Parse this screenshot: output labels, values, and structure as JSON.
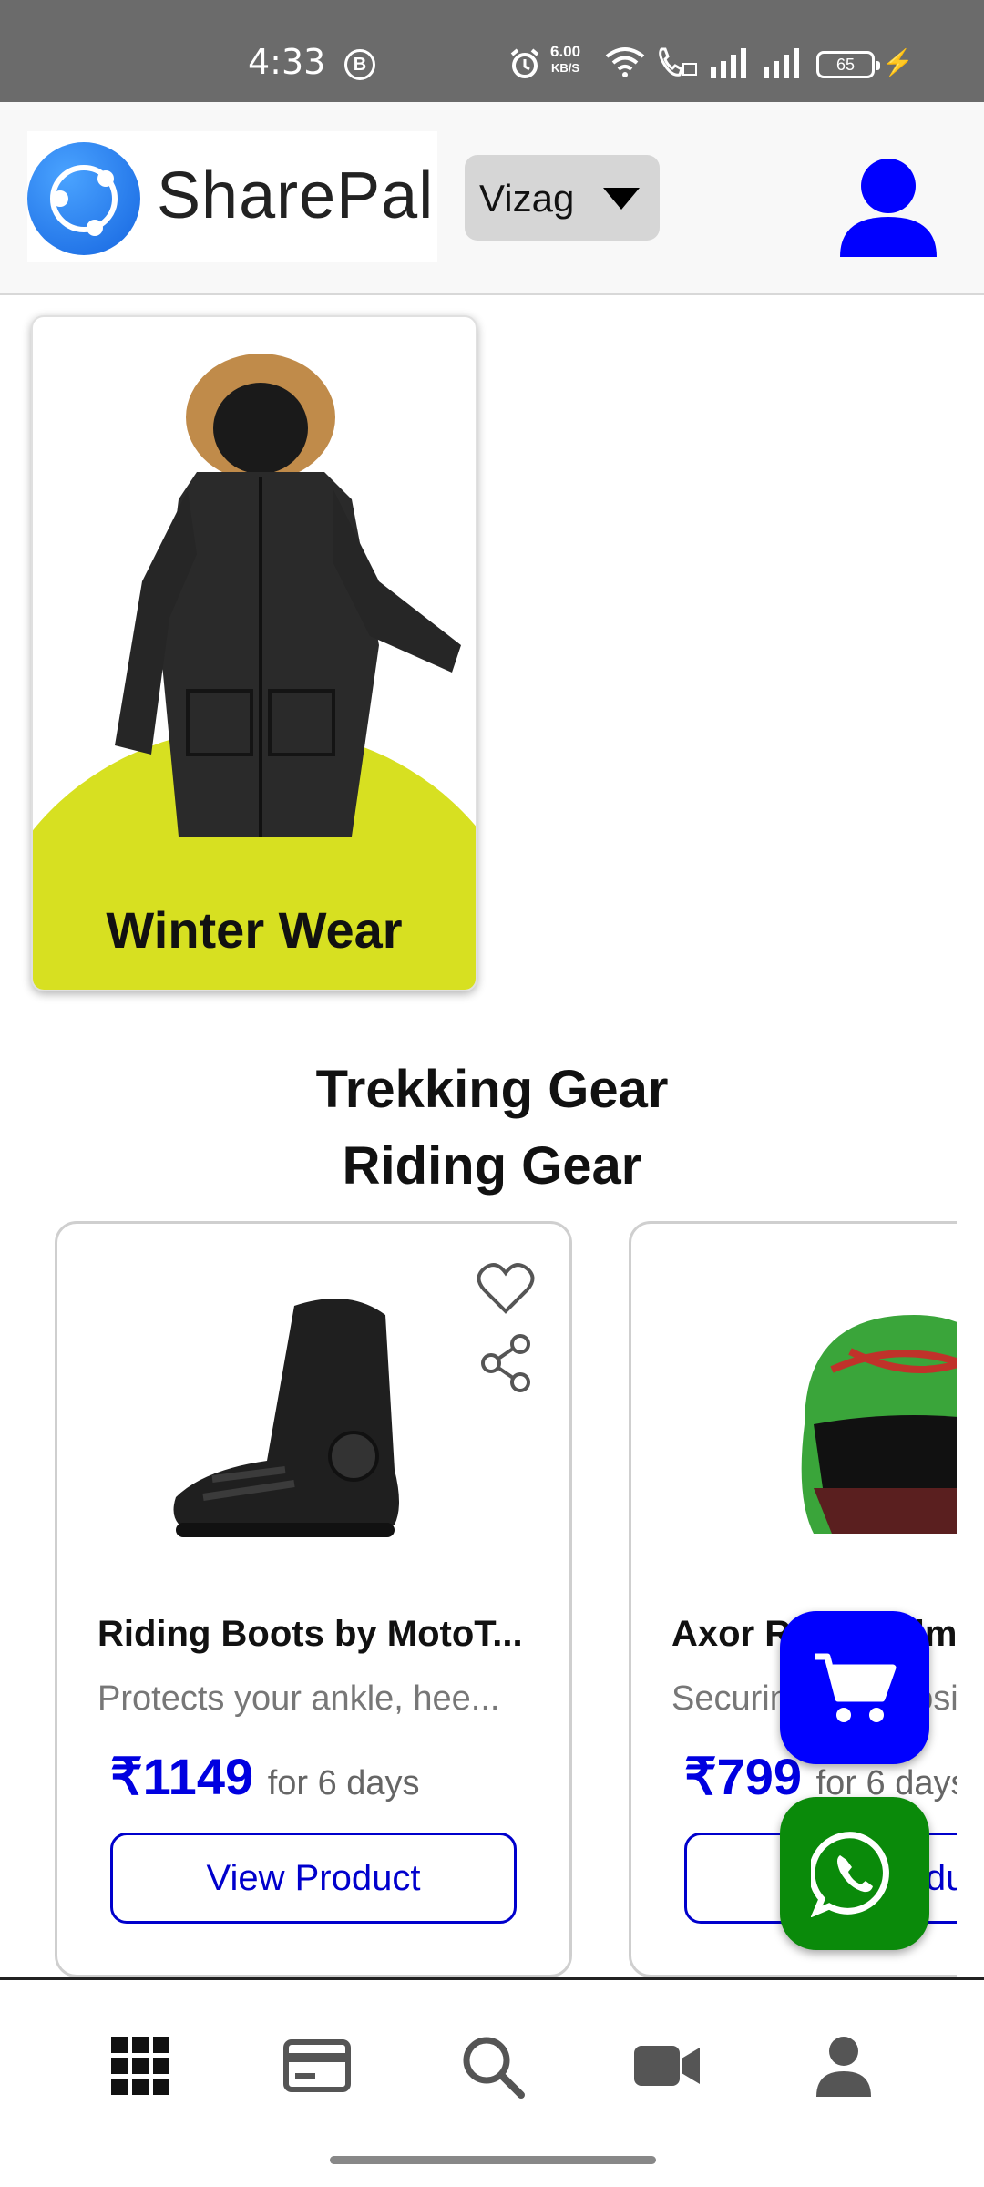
{
  "status_bar": {
    "time": "4:33",
    "b_badge": "B",
    "net_speed_value": "6.00",
    "net_speed_unit": "KB/S",
    "battery": "65"
  },
  "header": {
    "brand": "SharePal",
    "city": "Vizag"
  },
  "category_card": {
    "title": "Winter Wear",
    "accent": "#d7e021"
  },
  "sections": {
    "trekking": "Trekking Gear",
    "riding": "Riding Gear"
  },
  "products": [
    {
      "name": "Riding Boots by MotoT...",
      "description": "Protects your ankle, hee...",
      "price": "₹1149",
      "period": "for 6 days",
      "button": "View Product"
    },
    {
      "name": "Axor Rider Helm",
      "description": "Securing your posi",
      "price": "₹799",
      "period": "for 6 days",
      "button": "View Product"
    }
  ],
  "colors": {
    "primary": "#0000ff",
    "whatsapp": "#0a8a0a",
    "header_bg": "#f8f8f8"
  },
  "bottom_nav": [
    "grid-icon",
    "card-icon",
    "search-icon",
    "video-icon",
    "person-icon"
  ]
}
